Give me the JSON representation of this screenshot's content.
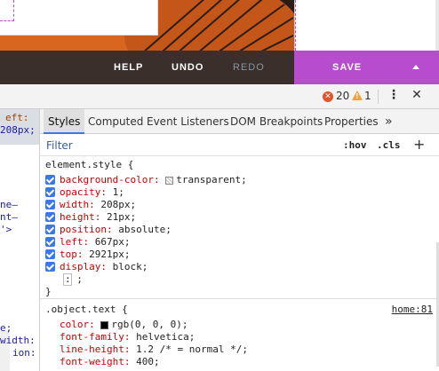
{
  "toolbar": {
    "help_label": "HELP",
    "undo_label": "UNDO",
    "redo_label": "REDO",
    "save_label": "SAVE",
    "save_color": "#b84ccf",
    "bg_color": "#3a2f2b"
  },
  "devtools": {
    "error_count": "20",
    "warning_count": "1",
    "error_icon": "error-icon",
    "warning_icon": "warning-icon",
    "menu_icon": "kebab-menu-icon",
    "close_icon": "close-icon",
    "tabs": [
      "Styles",
      "Computed",
      "Event Listeners",
      "DOM Breakpoints",
      "Properties"
    ],
    "more_tabs": "»",
    "active_tab": "Styles",
    "filter": {
      "placeholder": "Filter",
      "hov": ":hov",
      "cls": ".cls",
      "add": "+"
    }
  },
  "elements_panel": {
    "lines": [
      "eft:",
      "208px;",
      "ne–",
      "nt–",
      "'>",
      "e;",
      "width:",
      "ion:"
    ]
  },
  "rules": [
    {
      "selector": "element.style {",
      "declarations": [
        {
          "name": "background-color",
          "value": "transparent;",
          "swatch": "transparent"
        },
        {
          "name": "opacity",
          "value": "1;"
        },
        {
          "name": "width",
          "value": "208px;"
        },
        {
          "name": "height",
          "value": "21px;"
        },
        {
          "name": "position",
          "value": "absolute;"
        },
        {
          "name": "left",
          "value": "667px;"
        },
        {
          "name": "top",
          "value": "2921px;"
        },
        {
          "name": "display",
          "value": "block;"
        }
      ],
      "editing": ": ;",
      "close": "}"
    },
    {
      "selector": ".object.text {",
      "source": "home:81",
      "declarations": [
        {
          "name": "color",
          "value": "rgb(0, 0, 0);",
          "swatch": "black"
        },
        {
          "name": "font-family",
          "value": "helvetica;"
        },
        {
          "name": "line-height",
          "value": "1.2 /* = normal */;"
        },
        {
          "name": "font-weight",
          "value": "400;"
        }
      ]
    }
  ]
}
